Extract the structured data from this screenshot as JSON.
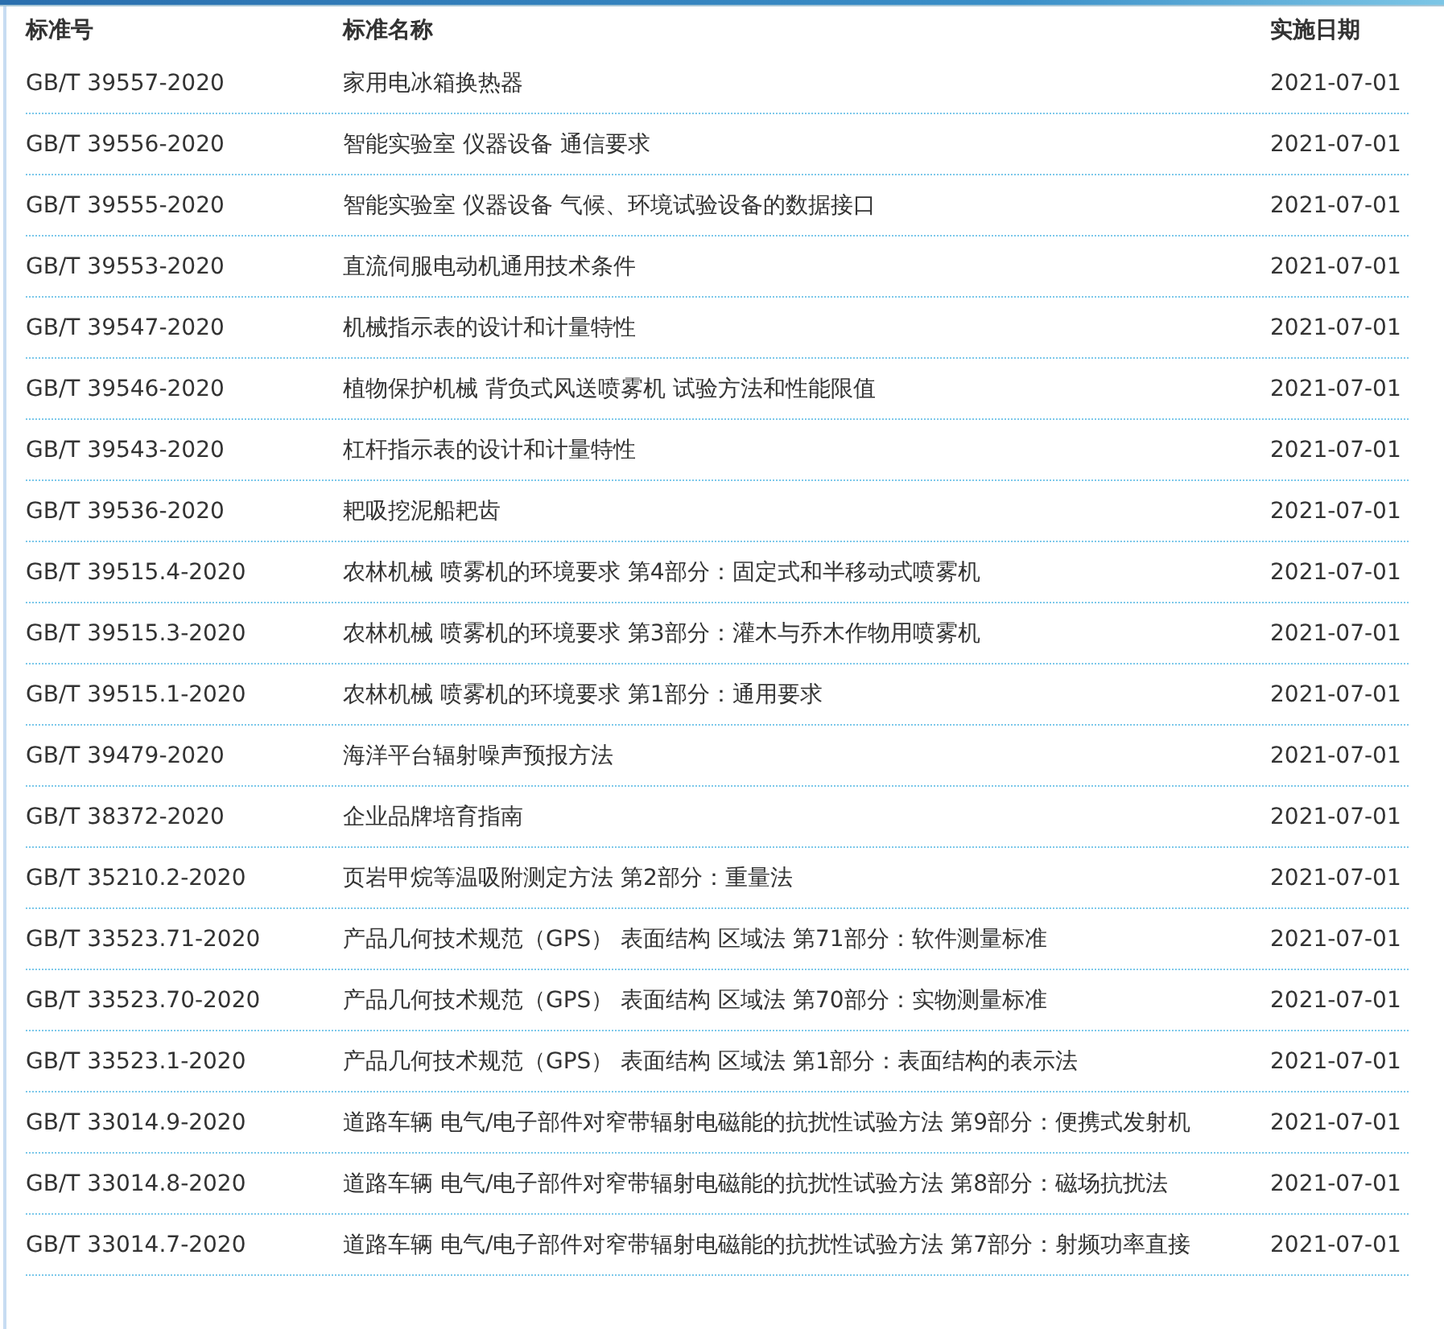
{
  "table": {
    "columns": [
      "标准号",
      "标准名称",
      "实施日期"
    ],
    "rows": [
      {
        "code": "GB/T 39557-2020",
        "name": "家用电冰箱换热器",
        "date": "2021-07-01"
      },
      {
        "code": "GB/T 39556-2020",
        "name": "智能实验室 仪器设备 通信要求",
        "date": "2021-07-01"
      },
      {
        "code": "GB/T 39555-2020",
        "name": "智能实验室 仪器设备 气候、环境试验设备的数据接口",
        "date": "2021-07-01"
      },
      {
        "code": "GB/T 39553-2020",
        "name": "直流伺服电动机通用技术条件",
        "date": "2021-07-01"
      },
      {
        "code": "GB/T 39547-2020",
        "name": "机械指示表的设计和计量特性",
        "date": "2021-07-01"
      },
      {
        "code": "GB/T 39546-2020",
        "name": "植物保护机械 背负式风送喷雾机 试验方法和性能限值",
        "date": "2021-07-01"
      },
      {
        "code": "GB/T 39543-2020",
        "name": "杠杆指示表的设计和计量特性",
        "date": "2021-07-01"
      },
      {
        "code": "GB/T 39536-2020",
        "name": "耙吸挖泥船耙齿",
        "date": "2021-07-01"
      },
      {
        "code": "GB/T 39515.4-2020",
        "name": "农林机械 喷雾机的环境要求 第4部分：固定式和半移动式喷雾机",
        "date": "2021-07-01"
      },
      {
        "code": "GB/T 39515.3-2020",
        "name": "农林机械 喷雾机的环境要求 第3部分：灌木与乔木作物用喷雾机",
        "date": "2021-07-01"
      },
      {
        "code": "GB/T 39515.1-2020",
        "name": "农林机械 喷雾机的环境要求 第1部分：通用要求",
        "date": "2021-07-01"
      },
      {
        "code": "GB/T 39479-2020",
        "name": "海洋平台辐射噪声预报方法",
        "date": "2021-07-01"
      },
      {
        "code": "GB/T 38372-2020",
        "name": "企业品牌培育指南",
        "date": "2021-07-01"
      },
      {
        "code": "GB/T 35210.2-2020",
        "name": "页岩甲烷等温吸附测定方法 第2部分：重量法",
        "date": "2021-07-01"
      },
      {
        "code": "GB/T 33523.71-2020",
        "name": "产品几何技术规范（GPS） 表面结构 区域法 第71部分：软件测量标准",
        "date": "2021-07-01"
      },
      {
        "code": "GB/T 33523.70-2020",
        "name": "产品几何技术规范（GPS） 表面结构 区域法 第70部分：实物测量标准",
        "date": "2021-07-01"
      },
      {
        "code": "GB/T 33523.1-2020",
        "name": "产品几何技术规范（GPS） 表面结构 区域法 第1部分：表面结构的表示法",
        "date": "2021-07-01"
      },
      {
        "code": "GB/T 33014.9-2020",
        "name": "道路车辆 电气/电子部件对窄带辐射电磁能的抗扰性试验方法 第9部分：便携式发射机",
        "date": "2021-07-01"
      },
      {
        "code": "GB/T 33014.8-2020",
        "name": "道路车辆 电气/电子部件对窄带辐射电磁能的抗扰性试验方法 第8部分：磁场抗扰法",
        "date": "2021-07-01"
      },
      {
        "code": "GB/T 33014.7-2020",
        "name": "道路车辆 电气/电子部件对窄带辐射电磁能的抗扰性试验方法 第7部分：射频功率直接",
        "date": "2021-07-01"
      }
    ]
  }
}
